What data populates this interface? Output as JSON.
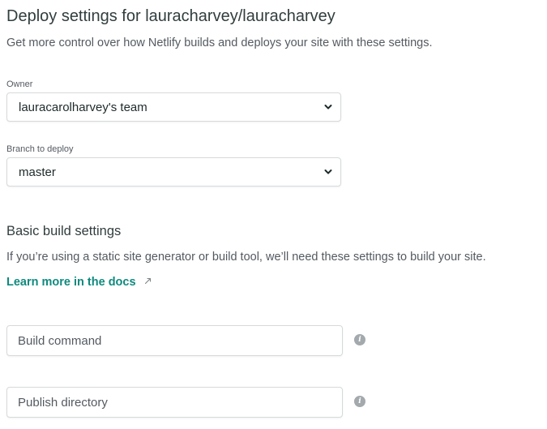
{
  "page": {
    "title": "Deploy settings for lauracharvey/lauracharvey",
    "subtitle": "Get more control over how Netlify builds and deploys your site with these settings."
  },
  "owner": {
    "label": "Owner",
    "value": "lauracarolharvey's team"
  },
  "branch": {
    "label": "Branch to deploy",
    "value": "master"
  },
  "basic_build": {
    "title": "Basic build settings",
    "description": "If you’re using a static site generator or build tool, we’ll need these settings to build your site.",
    "docs_link": "Learn more in the docs"
  },
  "build_command": {
    "placeholder": "Build command",
    "value": ""
  },
  "publish_directory": {
    "placeholder": "Publish directory",
    "value": ""
  },
  "icons": {
    "select_chevron": "chevron-down-icon",
    "external_link": "external-link-icon",
    "info": "info-icon"
  },
  "colors": {
    "link": "#0e8a7e",
    "text": "#313d3e",
    "muted_text": "#545a61",
    "border": "#d6d9db",
    "info_icon": "#a3a9ac"
  }
}
